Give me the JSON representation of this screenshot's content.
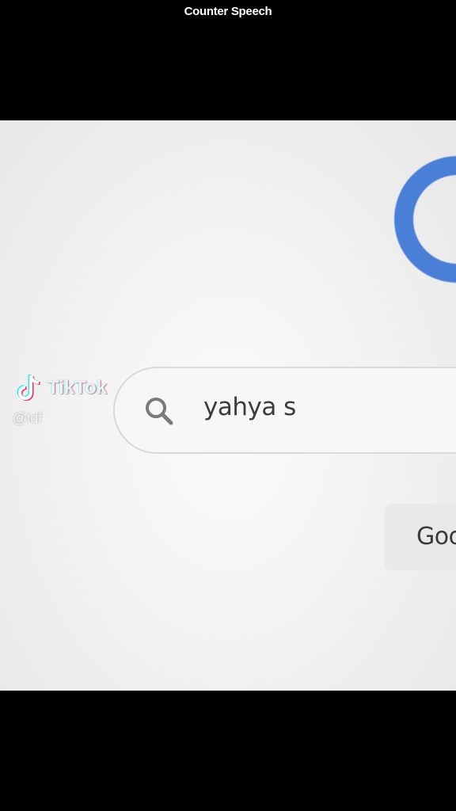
{
  "caption": "Counter Speech",
  "search": {
    "query": "yahya s",
    "icon": "search-icon"
  },
  "google_button": {
    "label": "Goo"
  },
  "watermark": {
    "brand": "TikTok",
    "handle": "@idf",
    "icon": "tiktok-logo-icon"
  },
  "colors": {
    "logo_blue": "#4a7fd8",
    "background": "#f1f1f1",
    "letterbox": "#000000"
  }
}
